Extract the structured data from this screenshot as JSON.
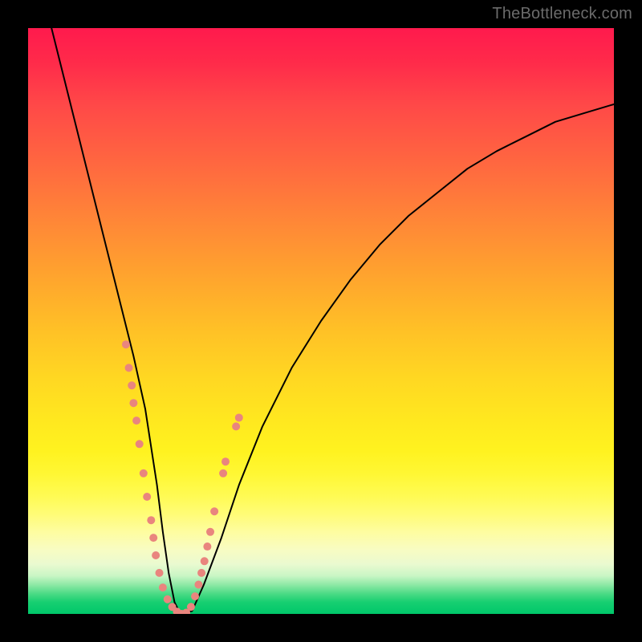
{
  "watermark": "TheBottleneck.com",
  "colors": {
    "page_bg": "#000000",
    "curve_stroke": "#000000",
    "marker_fill": "#e9857e",
    "gradient_top": "#ff1a4d",
    "gradient_bottom": "#00c76a"
  },
  "chart_data": {
    "type": "line",
    "title": "",
    "xlabel": "",
    "ylabel": "",
    "xlim": [
      0,
      100
    ],
    "ylim": [
      0,
      100
    ],
    "grid": false,
    "note": "V-shaped bottleneck curve. Y ≈ bottleneck mismatch percentage (0 = ideal match, green zone). X ≈ relative hardware ratio. Values estimated from the shape of the curve against the color gradient.",
    "series": [
      {
        "name": "bottleneck-curve",
        "x": [
          4,
          6,
          8,
          10,
          12,
          14,
          16,
          18,
          20,
          22,
          23,
          24,
          25,
          26,
          28,
          30,
          33,
          36,
          40,
          45,
          50,
          55,
          60,
          65,
          70,
          75,
          80,
          85,
          90,
          95,
          100
        ],
        "y": [
          100,
          92,
          84,
          76,
          68,
          60,
          52,
          44,
          35,
          22,
          14,
          7,
          2,
          0,
          0.5,
          5,
          13,
          22,
          32,
          42,
          50,
          57,
          63,
          68,
          72,
          76,
          79,
          81.5,
          84,
          85.5,
          87
        ]
      }
    ],
    "markers": {
      "note": "Pink dot markers clustered near the valley of the curve",
      "points_xy": [
        [
          16.7,
          46
        ],
        [
          17.2,
          42
        ],
        [
          17.7,
          39
        ],
        [
          18.0,
          36
        ],
        [
          18.5,
          33
        ],
        [
          19.0,
          29
        ],
        [
          19.7,
          24
        ],
        [
          20.3,
          20
        ],
        [
          21.0,
          16
        ],
        [
          21.4,
          13
        ],
        [
          21.8,
          10
        ],
        [
          22.4,
          7
        ],
        [
          23.0,
          4.5
        ],
        [
          23.8,
          2.5
        ],
        [
          24.6,
          1.2
        ],
        [
          25.4,
          0.4
        ],
        [
          26.2,
          0
        ],
        [
          27.0,
          0.2
        ],
        [
          27.8,
          1.2
        ],
        [
          28.5,
          3
        ],
        [
          29.1,
          5
        ],
        [
          29.6,
          7
        ],
        [
          30.1,
          9
        ],
        [
          30.6,
          11.5
        ],
        [
          31.1,
          14
        ],
        [
          31.8,
          17.5
        ],
        [
          33.3,
          24
        ],
        [
          33.7,
          26
        ],
        [
          35.5,
          32
        ],
        [
          36.0,
          33.5
        ]
      ],
      "radius": 5
    }
  }
}
